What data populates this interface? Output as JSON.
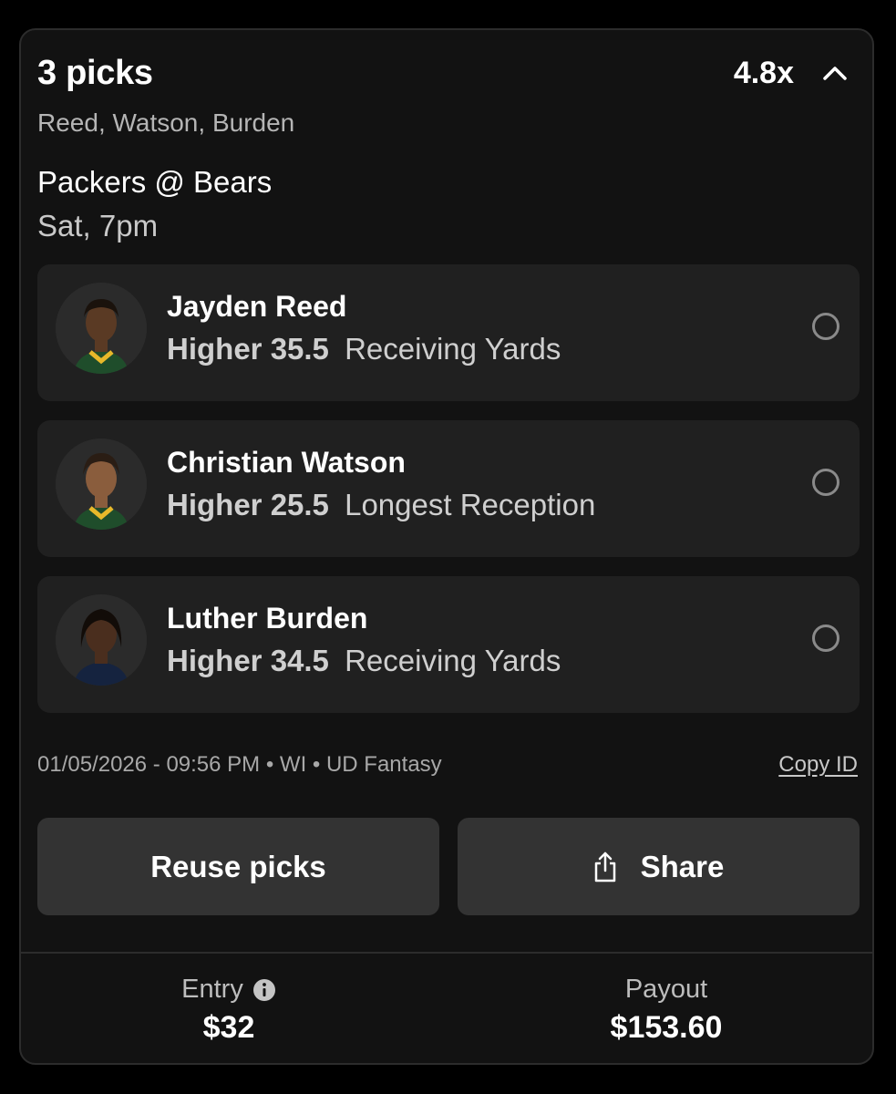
{
  "header": {
    "title": "3 picks",
    "multiplier": "4.8x",
    "players_summary": "Reed, Watson, Burden"
  },
  "game": {
    "matchup": "Packers @ Bears",
    "time": "Sat, 7pm"
  },
  "picks": [
    {
      "player": "Jayden Reed",
      "direction": "Higher",
      "line": "35.5",
      "stat": "Receiving Yards",
      "jersey_color": "#1f4d2b"
    },
    {
      "player": "Christian Watson",
      "direction": "Higher",
      "line": "25.5",
      "stat": "Longest Reception",
      "jersey_color": "#1f4d2b"
    },
    {
      "player": "Luther Burden",
      "direction": "Higher",
      "line": "34.5",
      "stat": "Receiving Yards",
      "jersey_color": "#15233f"
    }
  ],
  "meta": {
    "text": "01/05/2026 - 09:56 PM • WI • UD Fantasy",
    "copy_id_label": "Copy ID"
  },
  "actions": {
    "reuse_label": "Reuse picks",
    "share_label": "Share"
  },
  "footer": {
    "entry_label": "Entry",
    "entry_value": "$32",
    "payout_label": "Payout",
    "payout_value": "$153.60"
  },
  "icons": {
    "collapse": "chevron-up-icon",
    "share": "share-icon",
    "info": "info-icon",
    "status": "circle-outline-icon"
  }
}
